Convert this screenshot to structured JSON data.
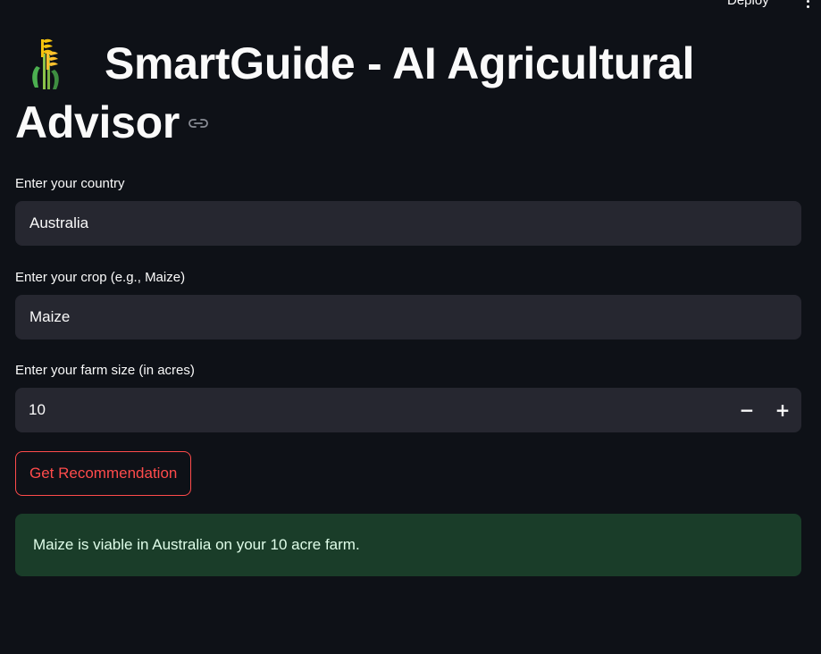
{
  "header": {
    "deploy_label": "Deploy",
    "menu_icon": "vertical-ellipsis-icon"
  },
  "page": {
    "title": "SmartGuide - AI Agricultural Advisor",
    "logo_icon": "sheaf-of-rice-icon",
    "anchor_icon": "link-icon"
  },
  "form": {
    "country": {
      "label": "Enter your country",
      "value": "Australia"
    },
    "crop": {
      "label": "Enter your crop (e.g., Maize)",
      "value": "Maize"
    },
    "farm_size": {
      "label": "Enter your farm size (in acres)",
      "value": "10",
      "decrement_label": "−",
      "increment_label": "+"
    },
    "submit_label": "Get Recommendation"
  },
  "result": {
    "message": "Maize is viable in Australia on your 10 acre farm."
  },
  "colors": {
    "background": "#0e1117",
    "input_bg": "#262730",
    "accent": "#ff4b4b",
    "success_bg": "#1a3d29",
    "success_text": "#dffde9"
  }
}
